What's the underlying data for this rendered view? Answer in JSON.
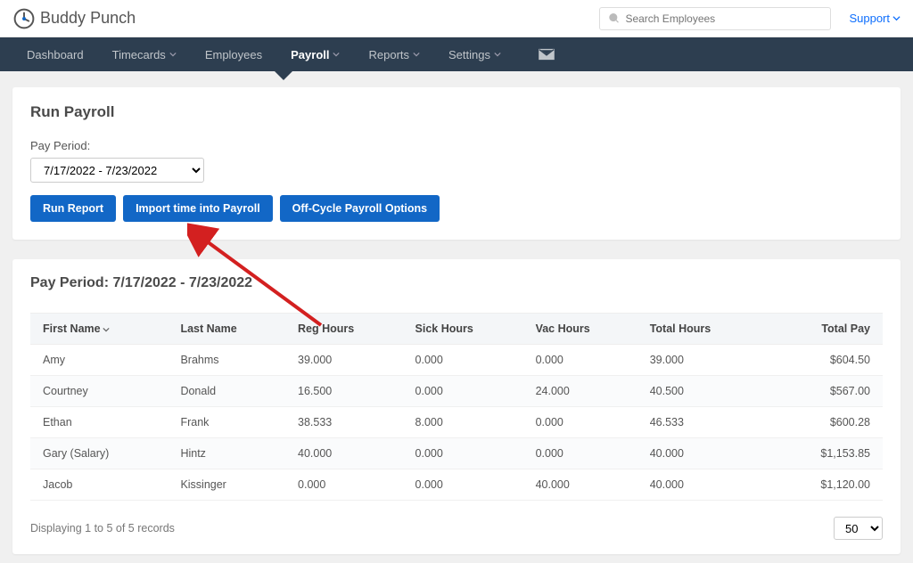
{
  "header": {
    "logo": {
      "left": "Buddy",
      "right": "Punch"
    },
    "search_placeholder": "Search Employees",
    "support_label": "Support"
  },
  "nav": {
    "items": [
      {
        "label": "Dashboard",
        "has_chev": false
      },
      {
        "label": "Timecards",
        "has_chev": true
      },
      {
        "label": "Employees",
        "has_chev": false
      },
      {
        "label": "Payroll",
        "has_chev": true,
        "active": true
      },
      {
        "label": "Reports",
        "has_chev": true
      },
      {
        "label": "Settings",
        "has_chev": true
      }
    ]
  },
  "run_payroll": {
    "title": "Run Payroll",
    "pay_period_label": "Pay Period:",
    "pay_period_value": "7/17/2022 - 7/23/2022",
    "buttons": {
      "run_report": "Run Report",
      "import_time": "Import time into Payroll",
      "off_cycle": "Off-Cycle Payroll Options"
    }
  },
  "results": {
    "title": "Pay Period: 7/17/2022 - 7/23/2022",
    "columns": {
      "first_name": "First Name",
      "last_name": "Last Name",
      "reg_hours": "Reg Hours",
      "sick_hours": "Sick Hours",
      "vac_hours": "Vac Hours",
      "total_hours": "Total Hours",
      "total_pay": "Total Pay"
    },
    "rows": [
      {
        "first_name": "Amy",
        "last_name": "Brahms",
        "reg_hours": "39.000",
        "sick_hours": "0.000",
        "vac_hours": "0.000",
        "total_hours": "39.000",
        "total_pay": "$604.50"
      },
      {
        "first_name": "Courtney",
        "last_name": "Donald",
        "reg_hours": "16.500",
        "sick_hours": "0.000",
        "vac_hours": "24.000",
        "total_hours": "40.500",
        "total_pay": "$567.00"
      },
      {
        "first_name": "Ethan",
        "last_name": "Frank",
        "reg_hours": "38.533",
        "sick_hours": "8.000",
        "vac_hours": "0.000",
        "total_hours": "46.533",
        "total_pay": "$600.28"
      },
      {
        "first_name": "Gary (Salary)",
        "last_name": "Hintz",
        "reg_hours": "40.000",
        "sick_hours": "0.000",
        "vac_hours": "0.000",
        "total_hours": "40.000",
        "total_pay": "$1,153.85"
      },
      {
        "first_name": "Jacob",
        "last_name": "Kissinger",
        "reg_hours": "0.000",
        "sick_hours": "0.000",
        "vac_hours": "40.000",
        "total_hours": "40.000",
        "total_pay": "$1,120.00"
      }
    ],
    "footer_text": "Displaying 1 to 5 of 5 records",
    "page_size": "50"
  }
}
